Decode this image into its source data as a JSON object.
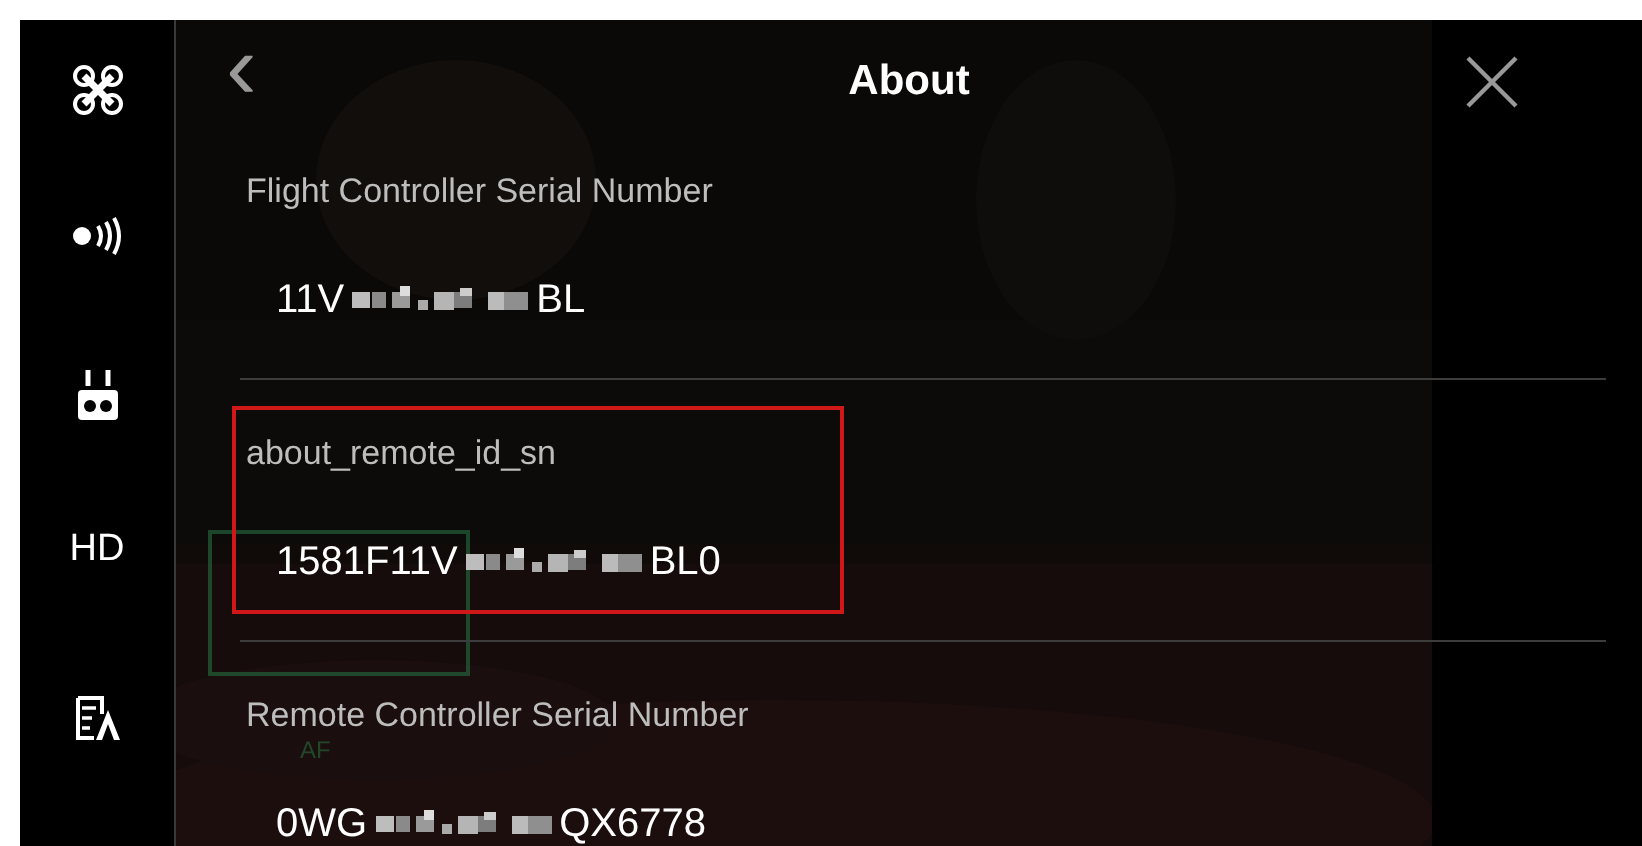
{
  "sidebar": {
    "items": [
      {
        "kind": "drone"
      },
      {
        "kind": "signal"
      },
      {
        "kind": "remote"
      },
      {
        "kind": "text",
        "label": "HD"
      },
      {
        "kind": "language"
      }
    ]
  },
  "header": {
    "back": "‹",
    "title": "About"
  },
  "camera_view": {
    "kind": "picture",
    "focus_frame": {
      "label": "AF"
    }
  },
  "rows": [
    {
      "label": "Flight Controller Serial Number",
      "value_start": "11V",
      "value_end": "BL",
      "redacted": true,
      "highlighted": false
    },
    {
      "label": "about_remote_id_sn",
      "value_start": "1581F11V",
      "value_end": "BL0",
      "redacted": true,
      "highlighted": true
    },
    {
      "label": "Remote Controller Serial Number",
      "value_start": "0WG",
      "value_end": "QX6778",
      "redacted": true,
      "highlighted": false
    }
  ]
}
